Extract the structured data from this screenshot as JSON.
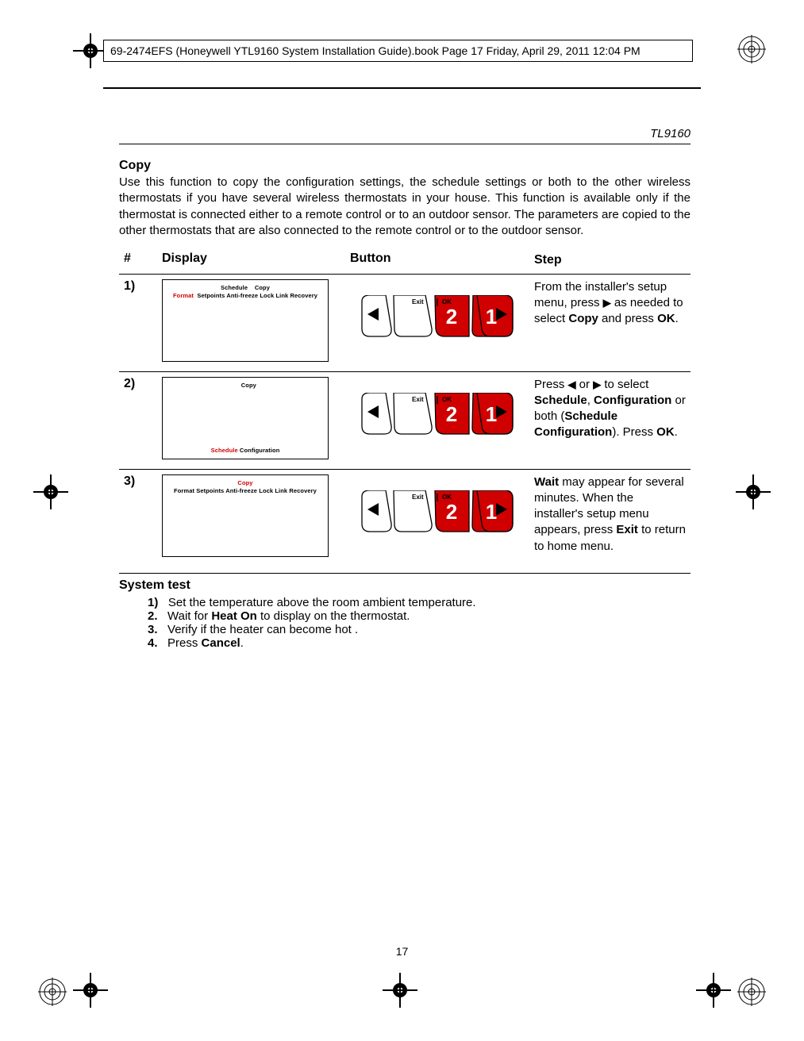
{
  "header": "69-2474EFS (Honeywell YTL9160 System Installation Guide).book  Page 17  Friday, April 29, 2011  12:04 PM",
  "model": "TL9160",
  "copy_title": "Copy",
  "copy_body": "Use this function to copy the configuration settings, the schedule settings or both to the other wireless thermostats if you have several wireless thermostats in your house. This function is available only if the thermostat is connected either to a remote control or to an outdoor sensor. The parameters are copied to the other thermostats that are also connected to the remote control or to the outdoor sensor.",
  "table": {
    "cols": {
      "num": "#",
      "display": "Display",
      "button": "Button",
      "step": "Step"
    },
    "rows": [
      {
        "num": "1)",
        "display": {
          "line1_pre": "Schedule",
          "line1_post": "Copy",
          "line2_pre": "Format  Setpoints  Anti-freeze  Lock  Link  Recovery",
          "line2_hl": "Format",
          "bottom": ""
        },
        "step_html": "From the installer's setup menu, press <span class=\"arrow-glyph\">▶</span> as needed to select <b>Copy</b> and press <b>OK</b>."
      },
      {
        "num": "2)",
        "display": {
          "line1_pre": "",
          "line1_post": "Copy",
          "line2_pre": "",
          "bottom_hl": "Schedule",
          "bottom_post": "  Configuration"
        },
        "step_html": "Press <span class=\"arrow-glyph\">◀</span> or <span class=\"arrow-glyph\">▶</span> to select <b>Schedule</b>, <b>Configuration</b> or both (<b>Schedule Configuration</b>). Press <b>OK</b>."
      },
      {
        "num": "3)",
        "display": {
          "line1_hl": "Copy",
          "line2_pre": "Format  Setpoints  Anti-freeze  Lock  Link  Recovery",
          "bottom": ""
        },
        "step_html": "<b>Wait</b> may appear for several minutes. When the installer's setup menu appears, press <b>Exit</b> to return to home menu."
      }
    ]
  },
  "buttons": {
    "exit": "Exit",
    "ok": "OK",
    "num1": "1",
    "num2": "2"
  },
  "systest_title": "System test",
  "systest": [
    {
      "n": "1)",
      "html": "Set the temperature above the room ambient temperature."
    },
    {
      "n": "2.",
      "html": "Wait for <b>Heat On</b>  to display on the thermostat."
    },
    {
      "n": "3.",
      "html": "Verify if the heater can become hot ."
    },
    {
      "n": "4.",
      "html": "Press <b>Cancel</b>."
    }
  ],
  "pagenum": "17"
}
